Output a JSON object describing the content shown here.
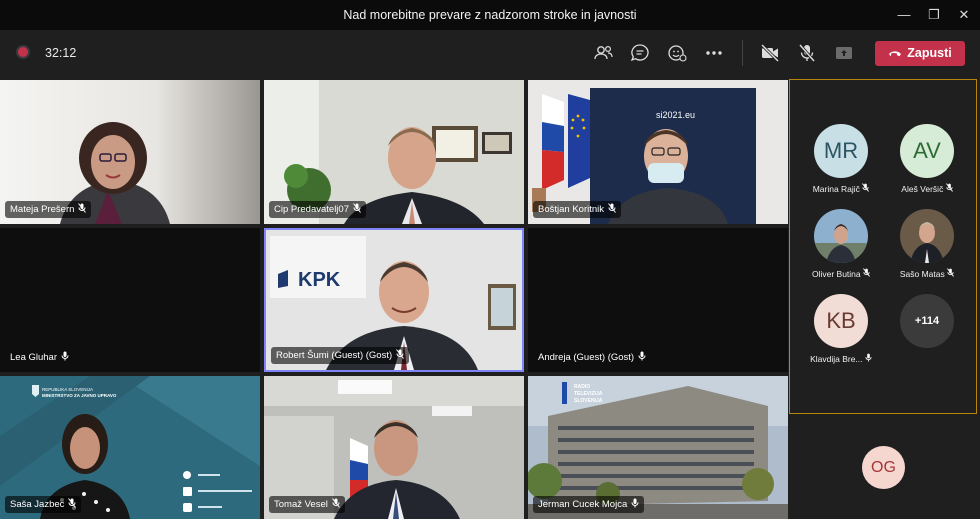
{
  "window": {
    "title": "Nad morebitne prevare z nadzorom stroke in javnosti"
  },
  "toolbar": {
    "timer": "32:12",
    "leave_label": "Zapusti"
  },
  "tiles": [
    {
      "name": "Mateja Prešern"
    },
    {
      "name": "Cip Predavatelj07"
    },
    {
      "name": "Boštjan Koritnik"
    },
    {
      "name": "Lea Gluhar"
    },
    {
      "name": "Robert Šumi (Guest) (Gost)"
    },
    {
      "name": "Andreja (Guest) (Gost)"
    },
    {
      "name": "Saša Jazbec"
    },
    {
      "name": "Tomaž Vesel"
    },
    {
      "name": "Jerman Cucek Mojca"
    }
  ],
  "scene_text": {
    "kpk": "KPK",
    "si2021": "si2021.eu",
    "ministry_line1": "REPUBLIKA SLOVENIJA",
    "ministry_line2": "MINISTRSTVO ZA JAVNO UPRAVO",
    "rtv_line1": "RADIO",
    "rtv_line2": "TELEVIZIJA",
    "rtv_line3": "SLOVENIJA"
  },
  "roster": {
    "people": [
      {
        "initials": "MR",
        "name": "Marina Rajič",
        "color": "#c8dfe6",
        "text_color": "#2c5563"
      },
      {
        "initials": "AV",
        "name": "Aleš Veršič",
        "color": "#d6ecd6",
        "text_color": "#2e6b37"
      },
      {
        "initials": "",
        "name": "Oliver Butina"
      },
      {
        "initials": "",
        "name": "Sašo Matas"
      },
      {
        "initials": "KB",
        "name": "Klavdija Bre...",
        "color": "#f1dcd6",
        "text_color": "#6b3b31"
      }
    ],
    "more_count": "+114"
  },
  "self_avatar": {
    "initials": "OG"
  }
}
